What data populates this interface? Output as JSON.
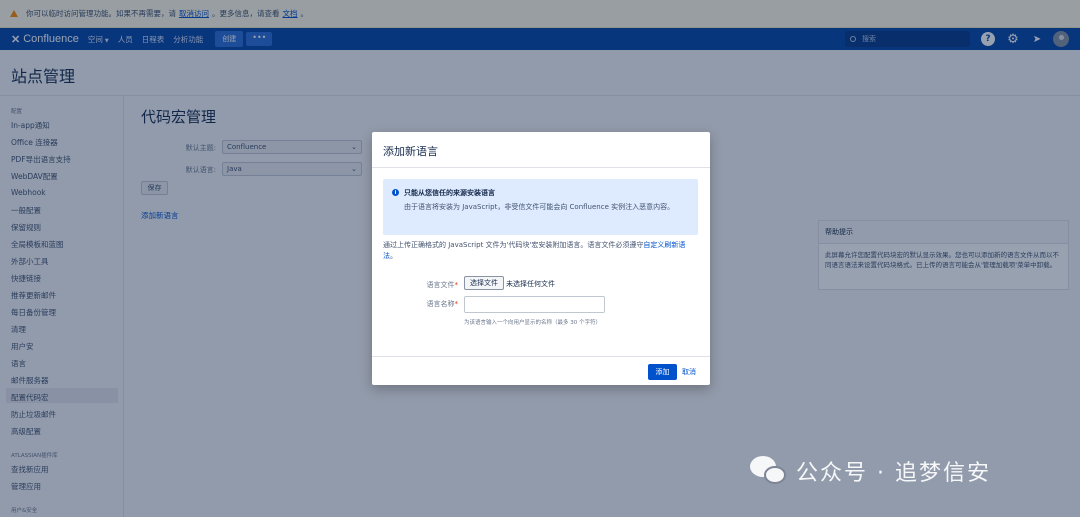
{
  "warning": {
    "text1": "你可以临时访问管理功能。如果不再需要，请",
    "link1": "取消访问",
    "text2": "。更多信息，请查看",
    "link2": "文档",
    "text3": "。"
  },
  "nav": {
    "logo": "Confluence",
    "items": [
      "空间",
      "人员",
      "日程表",
      "分析功能"
    ],
    "create": "创建",
    "more": "•••",
    "search_placeholder": "搜索"
  },
  "page": {
    "title": "站点管理"
  },
  "sidebar": {
    "section1": "配置",
    "items": [
      "In-app通知",
      "Office 连接器",
      "PDF导出语言支持",
      "WebDAV配置",
      "Webhook",
      "一般配置",
      "保留规则",
      "全局模板和蓝图",
      "外部小工具",
      "快捷链接",
      "推荐更新邮件",
      "每日备份管理",
      "清理",
      "用户安",
      "语言",
      "邮件服务器",
      "配置代码宏",
      "防止垃圾邮件",
      "高级配置"
    ],
    "section2": "ATLASSIAN插件库",
    "items2": [
      "查找新应用",
      "管理应用"
    ],
    "section3": "用户&安全"
  },
  "main": {
    "title": "代码宏管理",
    "theme_label": "默认主题:",
    "theme_value": "Confluence",
    "lang_label": "默认语言:",
    "lang_value": "Java",
    "save": "保存",
    "add_language": "添加新语言"
  },
  "help": {
    "title": "帮助提示",
    "text": "此屏幕允许您配置代码块宏的默认显示效果。您也可以添加新的语言文件从而以不同语言语法来设置代码块格式。已上传的语言可能会从'管理加载项'菜单中卸载。"
  },
  "dialog": {
    "title": "添加新语言",
    "info_title": "只能从您信任的来源安装语言",
    "info_text": "由于语言将安装为 JavaScript，非受信文件可能会向 Confluence 实例注入恶意内容。",
    "desc_text": "通过上传正确格式的 JavaScript 文件为'代码块'宏安装附加语言。语言文件必须遵守",
    "desc_link": "自定义刷新语法",
    "desc_end": "。",
    "file_label": "语言文件",
    "file_button": "选择文件",
    "file_status": "未选择任何文件",
    "name_label": "语言名称",
    "name_value": "",
    "hint": "为该语言输入一个向用户显示的名称（最多 30 个字符）",
    "add": "添加",
    "cancel": "取消"
  },
  "watermark": {
    "text": "公众号 · 追梦信安"
  }
}
